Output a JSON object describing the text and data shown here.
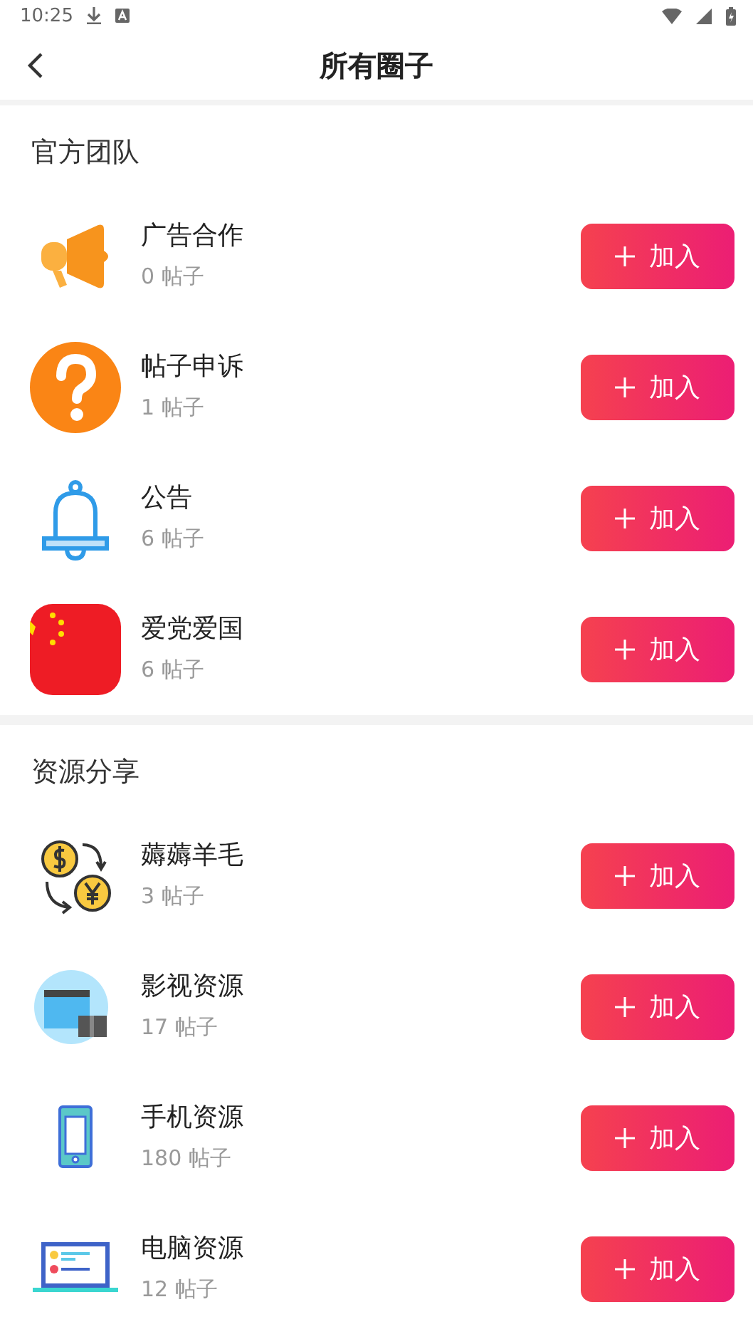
{
  "status_bar": {
    "time": "10:25"
  },
  "header": {
    "title": "所有圈子"
  },
  "sections": [
    {
      "title": "官方团队",
      "items": [
        {
          "name": "广告合作",
          "count": "0 帖子",
          "button": "加入"
        },
        {
          "name": "帖子申诉",
          "count": "1 帖子",
          "button": "加入"
        },
        {
          "name": "公告",
          "count": "6 帖子",
          "button": "加入"
        },
        {
          "name": "爱党爱国",
          "count": "6 帖子",
          "button": "加入"
        }
      ]
    },
    {
      "title": "资源分享",
      "items": [
        {
          "name": "薅薅羊毛",
          "count": "3 帖子",
          "button": "加入"
        },
        {
          "name": "影视资源",
          "count": "17 帖子",
          "button": "加入"
        },
        {
          "name": "手机资源",
          "count": "180 帖子",
          "button": "加入"
        },
        {
          "name": "电脑资源",
          "count": "12 帖子",
          "button": "加入"
        }
      ]
    }
  ]
}
